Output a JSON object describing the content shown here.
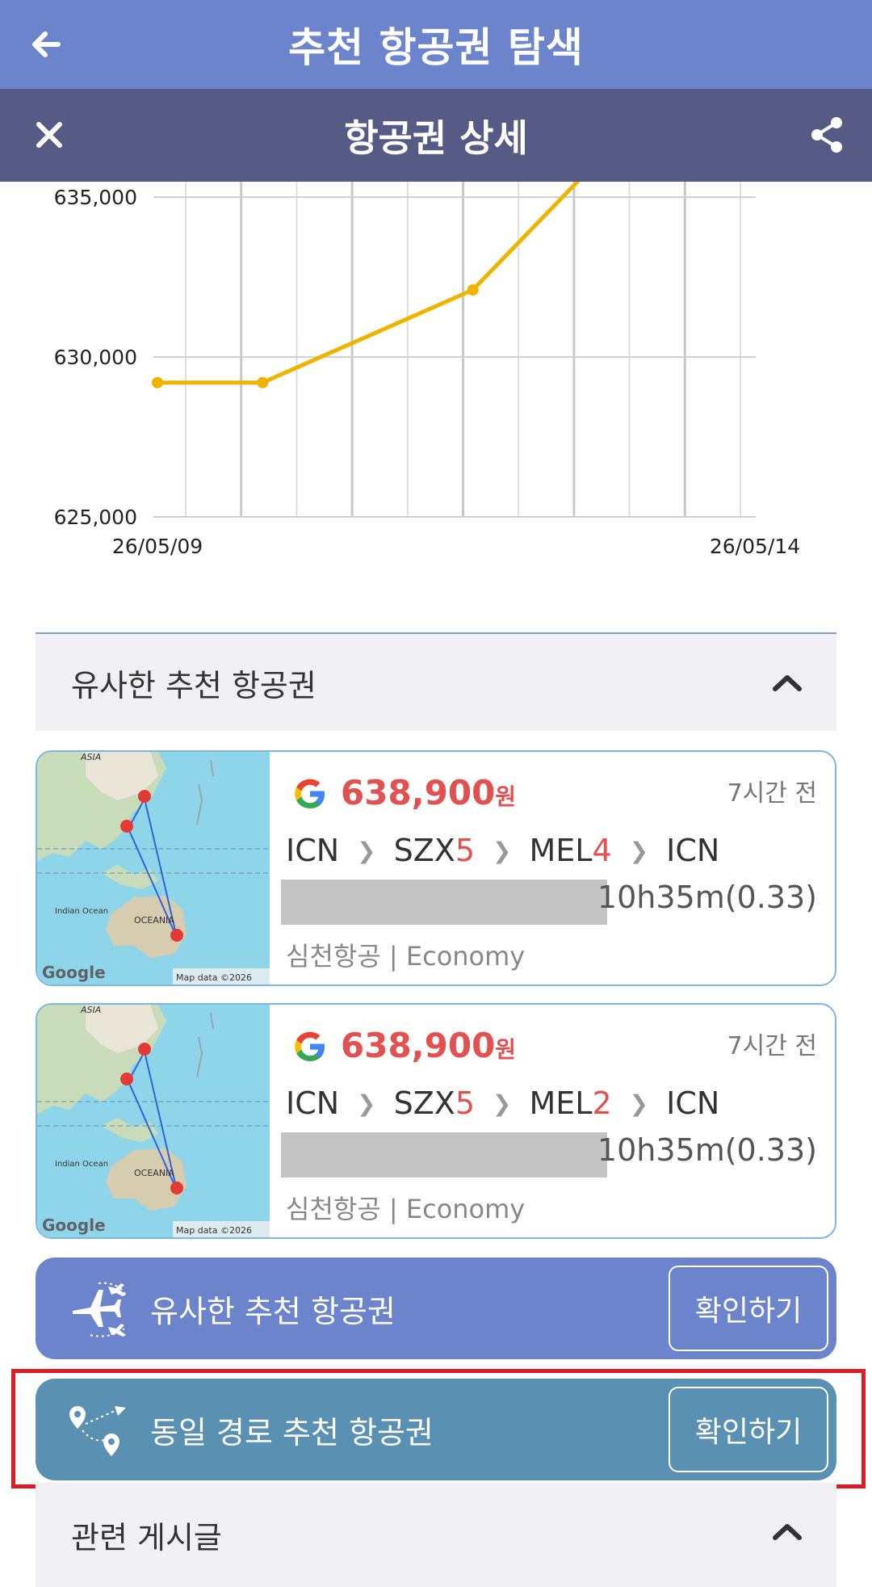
{
  "header": {
    "title": "추천 항공권 탐색",
    "back_icon": "arrow-left-icon"
  },
  "subheader": {
    "title": "항공권 상세",
    "close_icon": "close-icon",
    "share_icon": "share-icon"
  },
  "chart_data": {
    "type": "line",
    "title": "",
    "xlabel": "",
    "ylabel": "",
    "x": [
      "26/05/09",
      "26/05/10",
      "26/05/12",
      "26/05/14"
    ],
    "values": [
      629200,
      629200,
      632100,
      638900
    ],
    "ylim": [
      625000,
      637000
    ],
    "yticks": [
      "625,000",
      "630,000",
      "635,000"
    ],
    "xtick_labels": [
      "26/05/09",
      "26/05/14"
    ],
    "grid": true,
    "color": "#f0b400"
  },
  "similar_section": {
    "title": "유사한 추천 항공권",
    "chevron_icon": "chevron-up-icon"
  },
  "flights": [
    {
      "price": "638,900",
      "currency": "원",
      "time_ago": "7시간 전",
      "route": [
        {
          "code": "ICN",
          "stop": ""
        },
        {
          "code": "SZX",
          "stop": "5"
        },
        {
          "code": "MEL",
          "stop": "4"
        },
        {
          "code": "ICN",
          "stop": ""
        }
      ],
      "duration": "10h35m(0.33)",
      "airline": "심천항공 | Economy",
      "map_labels": {
        "asia": "ASIA",
        "ocean": "Indian Ocean",
        "oceania": "OCEANIA",
        "brand": "Google",
        "credit": "Map data ©2026"
      }
    },
    {
      "price": "638,900",
      "currency": "원",
      "time_ago": "7시간 전",
      "route": [
        {
          "code": "ICN",
          "stop": ""
        },
        {
          "code": "SZX",
          "stop": "5"
        },
        {
          "code": "MEL",
          "stop": "2"
        },
        {
          "code": "ICN",
          "stop": ""
        }
      ],
      "duration": "10h35m(0.33)",
      "airline": "심천항공 | Economy",
      "map_labels": {
        "asia": "ASIA",
        "ocean": "Indian Ocean",
        "oceania": "OCEANIA",
        "brand": "Google",
        "credit": "Map data ©2026"
      }
    }
  ],
  "actions": [
    {
      "label": "유사한 추천 항공권",
      "button": "확인하기",
      "color": "#6b84cc",
      "icon": "planes-icon"
    },
    {
      "label": "동일 경로 추천 항공권",
      "button": "확인하기",
      "color": "#5a91b3",
      "icon": "route-pins-icon"
    }
  ],
  "related_section": {
    "title": "관련 게시글",
    "chevron_icon": "chevron-up-icon"
  }
}
